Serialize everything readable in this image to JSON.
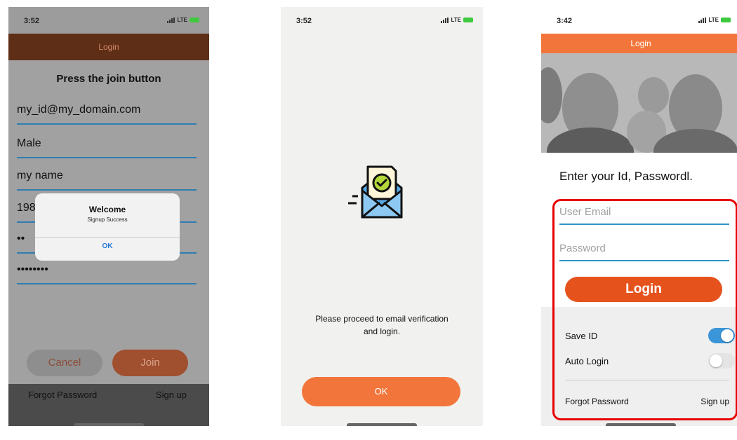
{
  "phone1": {
    "status": {
      "time": "3:52",
      "network": "LTE"
    },
    "nav_title": "Login",
    "instruction": "Press the join button",
    "fields": {
      "email": "my_id@my_domain.com",
      "gender": "Male",
      "name": "my name",
      "birth": "198",
      "pw1": "••",
      "pw2": "••••••••"
    },
    "cancel_label": "Cancel",
    "join_label": "Join",
    "forgot_password": "Forgot Password",
    "sign_up": "Sign up",
    "alert": {
      "title": "Welcome",
      "message": "Signup Success",
      "ok": "OK"
    }
  },
  "phone2": {
    "status": {
      "time": "3:52",
      "network": "LTE"
    },
    "message_line1": "Please proceed to email verification",
    "message_line2": "and login.",
    "ok_label": "OK",
    "icon": "email-verified-icon"
  },
  "phone3": {
    "status": {
      "time": "3:42",
      "network": "LTE"
    },
    "nav_title": "Login",
    "heading": "Enter your Id, Passwordl.",
    "email_placeholder": "User Email",
    "password_placeholder": "Password",
    "login_label": "Login",
    "save_id": {
      "label": "Save ID",
      "on": true
    },
    "auto_login": {
      "label": "Auto Login",
      "on": false
    },
    "forgot_password": "Forgot Password",
    "sign_up": "Sign up"
  },
  "colors": {
    "accent": "#f2763c",
    "link_blue": "#2a7ad5",
    "underline": "#2e93c7",
    "highlight_red": "#e60000"
  }
}
